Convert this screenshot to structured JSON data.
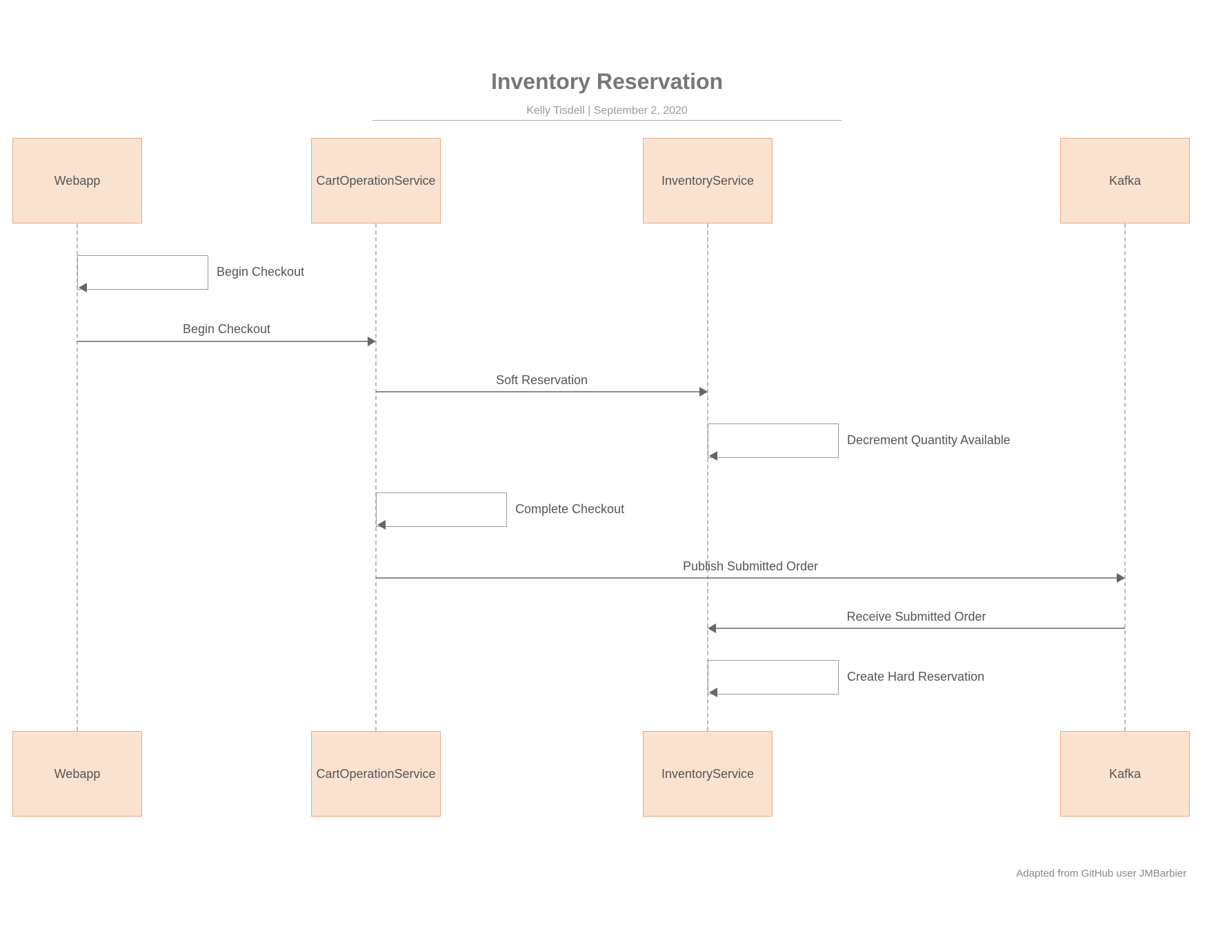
{
  "header": {
    "title": "Inventory Reservation",
    "author": "Kelly Tisdell",
    "sep": "  |  ",
    "date": "September 2, 2020",
    "credit": "Adapted from GitHub user JMBarbier"
  },
  "participants": {
    "p1": "Webapp",
    "p2": "CartOperationService",
    "p3": "InventoryService",
    "p4": "Kafka"
  },
  "messages": {
    "m1": "Begin Checkout",
    "m2": "Begin Checkout",
    "m3": "Soft Reservation",
    "m4": "Decrement Quantity Available",
    "m5": "Complete Checkout",
    "m6": "Publish Submitted Order",
    "m7": "Receive Submitted Order",
    "m8": "Create Hard Reservation"
  },
  "layout": {
    "lanes": {
      "p1": 112,
      "p2": 545,
      "p3": 1026,
      "p4": 1631
    },
    "topBoxY": 200,
    "botBoxY": 1060,
    "boxHeight": 124,
    "boxWidths": {
      "p1": 188,
      "p2": 188,
      "p3": 188,
      "p4": 188
    },
    "lifelineTop": 324,
    "lifelineBot": 1060,
    "selfLoopWidth": 190,
    "msgs": [
      {
        "id": "m1",
        "type": "self",
        "from": "p1",
        "selfY": 370,
        "labelY": 384
      },
      {
        "id": "m2",
        "type": "arrow",
        "from": "p1",
        "to": "p2",
        "lineY": 495,
        "labelY": 467
      },
      {
        "id": "m3",
        "type": "arrow",
        "from": "p2",
        "to": "p3",
        "lineY": 568,
        "labelY": 541
      },
      {
        "id": "m4",
        "type": "self",
        "from": "p3",
        "selfY": 614,
        "labelY": 628
      },
      {
        "id": "m5",
        "type": "self",
        "from": "p2",
        "selfY": 714,
        "labelY": 728
      },
      {
        "id": "m6",
        "type": "arrow",
        "from": "p2",
        "to": "p4",
        "lineY": 838,
        "labelY": 811
      },
      {
        "id": "m7",
        "type": "arrow",
        "from": "p4",
        "to": "p3",
        "lineY": 911,
        "labelY": 884
      },
      {
        "id": "m8",
        "type": "self",
        "from": "p3",
        "selfY": 957,
        "labelY": 971
      }
    ]
  }
}
